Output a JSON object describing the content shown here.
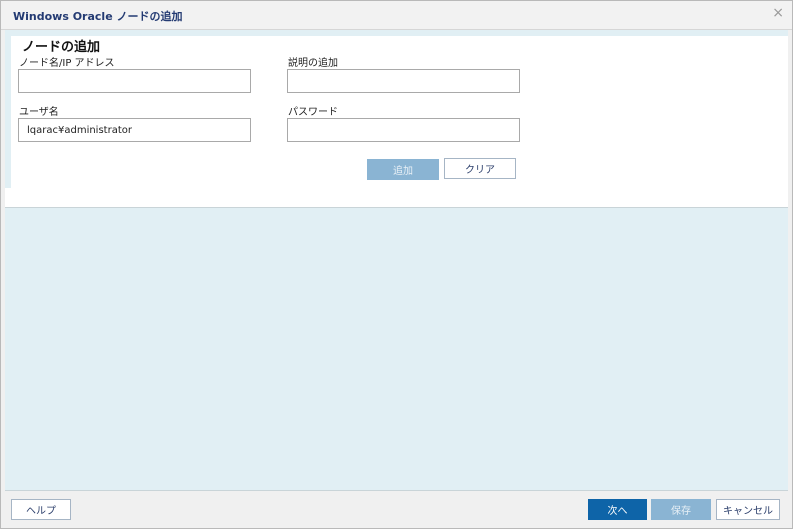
{
  "window": {
    "title": "Windows Oracle ノードの追加",
    "close_glyph": "×"
  },
  "form": {
    "section_title": "ノードの追加",
    "node_label": "ノード名/IP アドレス",
    "node_value": "",
    "description_label": "説明の追加",
    "description_value": "",
    "user_label": "ユーザ名",
    "user_value": "lqarac¥administrator",
    "password_label": "パスワード",
    "password_value": "",
    "add_button": "追加",
    "clear_button": "クリア"
  },
  "footer": {
    "help_button": "ヘルプ",
    "next_button": "次へ",
    "save_button": "保存",
    "cancel_button": "キャンセル"
  },
  "colors": {
    "primary": "#0e64a8",
    "disabled": "#8ab4d3",
    "panel_bg": "#e1eff4",
    "title_text": "#233a72"
  }
}
